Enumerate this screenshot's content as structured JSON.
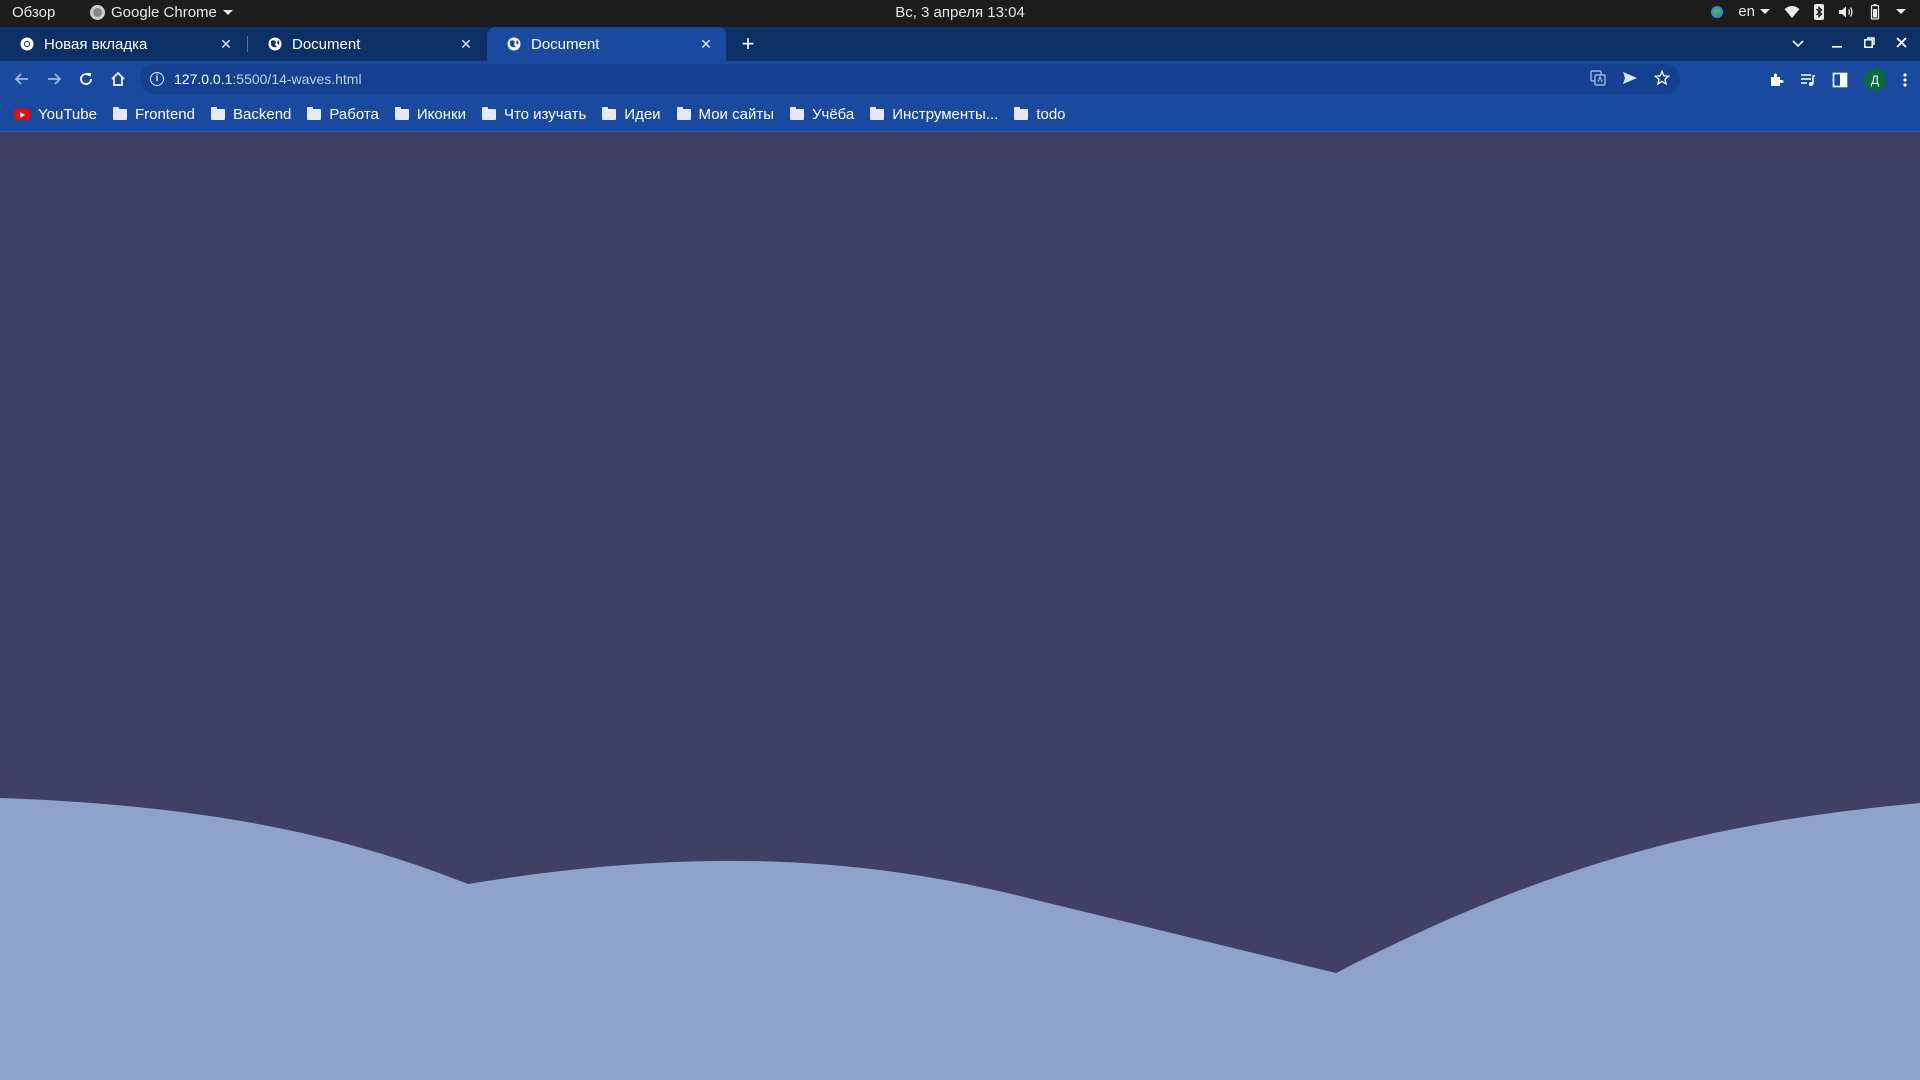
{
  "topbar": {
    "activities": "Обзор",
    "app_name": "Google Chrome",
    "clock": "Вс, 3 апреля  13:04",
    "language": "en"
  },
  "tabs": [
    {
      "title": "Новая вкладка",
      "active": false
    },
    {
      "title": "Document",
      "active": false
    },
    {
      "title": "Document",
      "active": true
    }
  ],
  "new_tab_symbol": "+",
  "omnibox": {
    "host": "127.0.0.1",
    "path": ":5500/14-waves.html"
  },
  "profile_initial": "Д",
  "bookmarks": [
    {
      "label": "YouTube",
      "icon": "youtube-icon"
    },
    {
      "label": "Frontend",
      "icon": "folder-icon"
    },
    {
      "label": "Backend",
      "icon": "folder-icon"
    },
    {
      "label": "Работа",
      "icon": "folder-icon"
    },
    {
      "label": "Иконки",
      "icon": "folder-icon"
    },
    {
      "label": "Что изучать",
      "icon": "folder-icon"
    },
    {
      "label": "Идеи",
      "icon": "folder-icon"
    },
    {
      "label": "Мои сайты",
      "icon": "folder-icon"
    },
    {
      "label": "Учёба",
      "icon": "folder-icon"
    },
    {
      "label": "Инструменты...",
      "icon": "folder-icon"
    },
    {
      "label": "todo",
      "icon": "folder-icon"
    }
  ],
  "colors": {
    "page_background": "#403f66",
    "wave_fill": "#8fa2cc",
    "chrome_frame": "#0c2f66",
    "chrome_toolbar": "#1a4aa0",
    "topbar": "#1c1c1c"
  }
}
